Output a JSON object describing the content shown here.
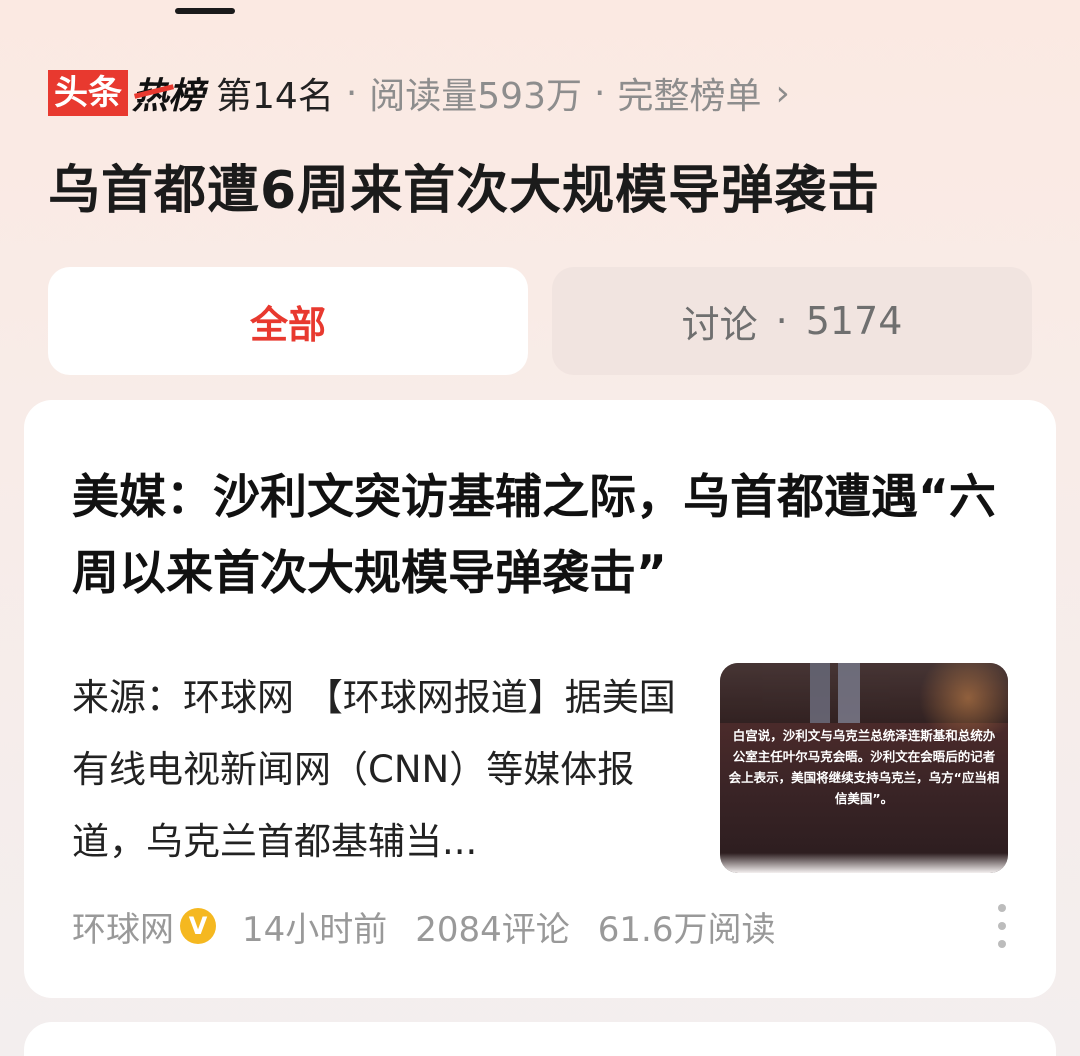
{
  "header": {
    "logo_toutiao": "头条",
    "logo_rebang": "热榜",
    "rank": "第14名",
    "sep": "·",
    "reads": "阅读量593万",
    "full_list": "完整榜单",
    "chevron": "›"
  },
  "topic": {
    "title": "乌首都遭6周来首次大规模导弹袭击"
  },
  "tabs": [
    {
      "label": "全部"
    },
    {
      "label": "讨论",
      "dot": "·",
      "count": "5174"
    }
  ],
  "article": {
    "title": "美媒：沙利文突访基辅之际，乌首都遭遇“六周以来首次大规模导弹袭击”",
    "summary": "来源：环球网 【环球网报道】据美国有线电视新闻网（CNN）等媒体报道，乌克兰首都基辅当...",
    "thumbnail_caption": "白宫说，沙利文与乌克兰总统泽连斯基和总统办公室主任叶尔马克会晤。沙利文在会晤后的记者会上表示，美国将继续支持乌克兰，乌方“应当相信美国”。",
    "source": "环球网",
    "verified_badge": "V",
    "time": "14小时前",
    "comments": "2084评论",
    "views": "61.6万阅读"
  },
  "colors": {
    "accent": "#e8392f",
    "muted": "#999999",
    "verified": "#f5b820"
  }
}
